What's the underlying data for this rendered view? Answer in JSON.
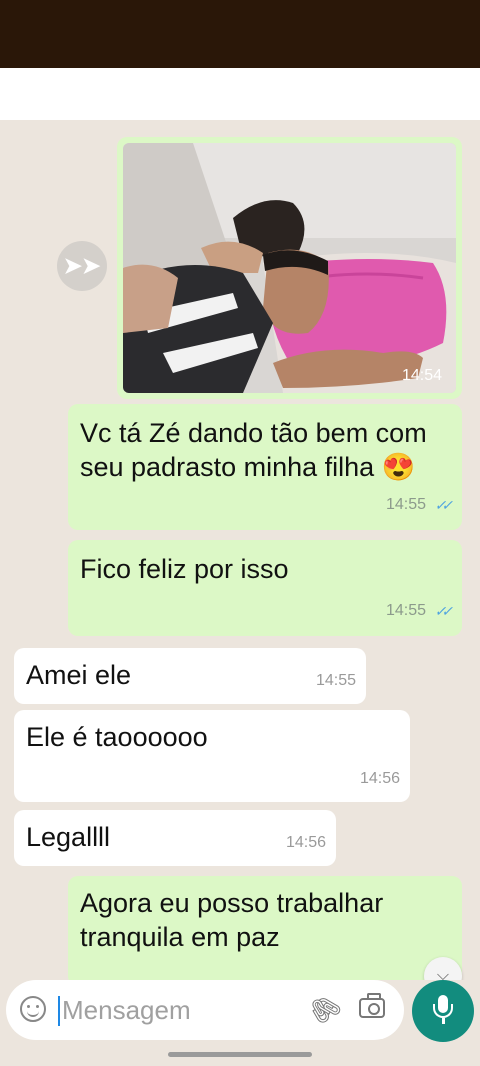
{
  "messages": [
    {
      "type": "image",
      "time": "14:54"
    },
    {
      "type": "out",
      "text": "Vc tá Zé dando tão bem com seu padrasto minha filha 😍",
      "time": "14:55"
    },
    {
      "type": "out",
      "text": "Fico feliz por isso",
      "time": "14:55"
    },
    {
      "type": "in",
      "text": "Amei ele",
      "time": "14:55"
    },
    {
      "type": "in",
      "text": "Ele é taoooooo",
      "time": "14:56"
    },
    {
      "type": "in",
      "text": "Legallll",
      "time": "14:56"
    },
    {
      "type": "out",
      "text": "Agora eu posso trabalhar tranquila em paz",
      "time": ""
    }
  ],
  "icons": {
    "forward": "forward-icon",
    "scroll_down": "double-chevron-down-icon",
    "emoji": "emoji-icon",
    "attach": "paperclip-icon",
    "camera": "camera-icon",
    "mic": "microphone-icon"
  },
  "input": {
    "placeholder": "Mensagem",
    "value": ""
  },
  "colors": {
    "outgoing": "#dcf8c6",
    "incoming": "#ffffff",
    "background": "#ece5dd",
    "mic_button": "#128c7e",
    "read_ticks": "#4fa3e0",
    "status_bar": "#2a1708"
  }
}
